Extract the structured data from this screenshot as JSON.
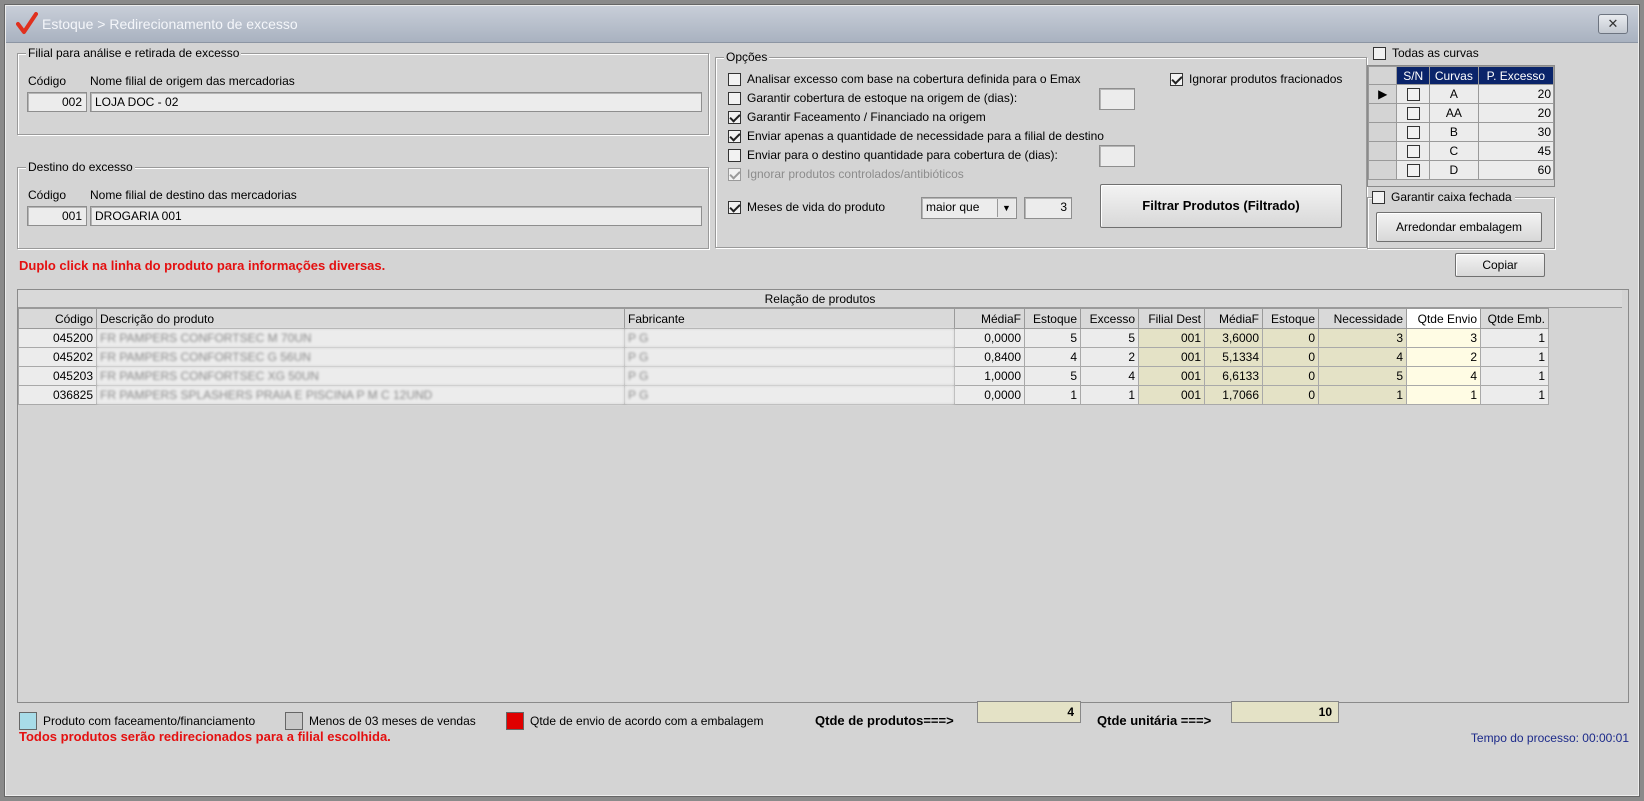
{
  "window": {
    "title": "Estoque > Redirecionamento de excesso",
    "close_label": "✕"
  },
  "origin": {
    "legend": "Filial para análise e retirada de excesso",
    "code_label": "Código",
    "name_label": "Nome filial de origem das mercadorias",
    "code": "002",
    "name": "LOJA DOC - 02"
  },
  "destination": {
    "legend": "Destino do excesso",
    "code_label": "Código",
    "name_label": "Nome filial de destino das mercadorias",
    "code": "001",
    "name": "DROGARIA 001"
  },
  "options": {
    "legend": "Opções",
    "items": [
      {
        "label": "Analisar excesso com base na cobertura definida para o Emax",
        "checked": false
      },
      {
        "label": "Garantir cobertura de estoque na origem de (dias):",
        "checked": false
      },
      {
        "label": "Garantir Faceamento / Financiado na origem",
        "checked": true
      },
      {
        "label": "Enviar apenas a quantidade de necessidade para a filial de destino",
        "checked": true
      },
      {
        "label": "Enviar para o destino quantidade para cobertura de (dias):",
        "checked": false
      },
      {
        "label": "Ignorar produtos controlados/antibióticos",
        "checked": true
      }
    ],
    "ignore_fractional_label": "Ignorar produtos fracionados",
    "months_label": "Meses de vida do produto",
    "months_operator": "maior que",
    "months_value": "3",
    "filter_button": "Filtrar Produtos (Filtrado)"
  },
  "curves": {
    "all_label": "Todas as curvas",
    "headers": [
      "S/N",
      "Curvas",
      "P. Excesso"
    ],
    "rows": [
      {
        "curve": "A",
        "pct": "20"
      },
      {
        "curve": "AA",
        "pct": "20"
      },
      {
        "curve": "B",
        "pct": "30"
      },
      {
        "curve": "C",
        "pct": "45"
      },
      {
        "curve": "D",
        "pct": "60"
      }
    ]
  },
  "closed_box": {
    "label": "Garantir caixa fechada",
    "button": "Arredondar embalagem"
  },
  "hint": "Duplo click na linha do produto para informações diversas.",
  "copy_button": "Copiar",
  "products": {
    "caption": "Relação de produtos",
    "headers": [
      "Código",
      "Descrição do produto",
      "Fabricante",
      "MédiaF",
      "Estoque",
      "Excesso",
      "Filial Dest",
      "MédiaF",
      "Estoque",
      "Necessidade",
      "Qtde Envio",
      "Qtde Emb."
    ],
    "rows": [
      [
        "045200",
        "FR PAMPERS CONFORTSEC M 70UN",
        "P G",
        "0,0000",
        "5",
        "5",
        "001",
        "3,6000",
        "0",
        "3",
        "3",
        "1"
      ],
      [
        "045202",
        "FR PAMPERS CONFORTSEC G 56UN",
        "P G",
        "0,8400",
        "4",
        "2",
        "001",
        "5,1334",
        "0",
        "4",
        "2",
        "1"
      ],
      [
        "045203",
        "FR PAMPERS CONFORTSEC XG 50UN",
        "P G",
        "1,0000",
        "5",
        "4",
        "001",
        "6,6133",
        "0",
        "5",
        "4",
        "1"
      ],
      [
        "036825",
        "FR PAMPERS SPLASHERS PRAIA E PISCINA P M C 12UND",
        "P G",
        "0,0000",
        "1",
        "1",
        "001",
        "1,7066",
        "0",
        "1",
        "1",
        "1"
      ]
    ]
  },
  "legend_items": [
    {
      "label": "Produto com faceamento/financiamento",
      "color": "#a8dce8"
    },
    {
      "label": "Menos de 03 meses de vendas",
      "color": "#c8c8c8"
    },
    {
      "label": "Qtde de envio de acordo com a embalagem",
      "color": "#e00000"
    }
  ],
  "totals": {
    "products_label": "Qtde de produtos===>",
    "products_value": "4",
    "units_label": "Qtde unitária ===>",
    "units_value": "10"
  },
  "warning": "Todos produtos serão redirecionados para a filial escolhida.",
  "process_time": "Tempo do processo: 00:00:01"
}
